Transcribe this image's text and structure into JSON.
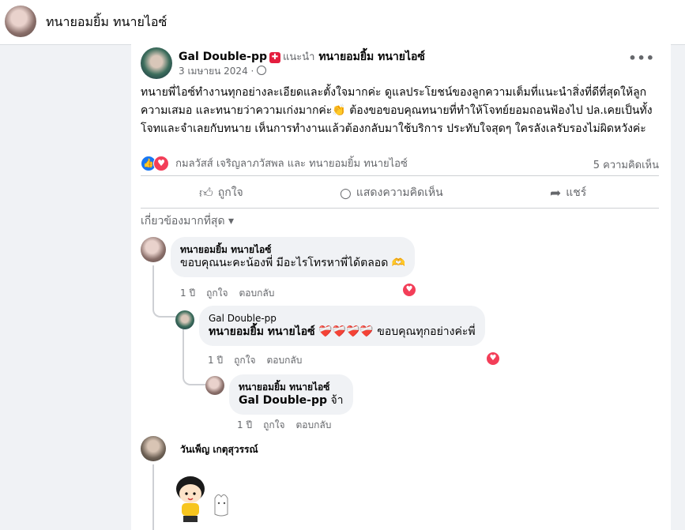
{
  "header": {
    "title": "ทนายอมยิ้ม ทนายไอซ์"
  },
  "post": {
    "author": "Gal Double-pp",
    "badge": "✚",
    "recommends_label": "แนะนำ",
    "page_name": "ทนายอมยิ้ม ทนายไอซ์",
    "date": "3 เมษายน 2024 ·",
    "more": "•••",
    "text": "ทนายพี่ไอซ์ทำงานทุกอย่างละเอียดและตั้งใจมากค่ะ ดูแลประโยชน์ของลูกความเต็มที่แนะนำสิ่งที่ดีที่สุดให้ลูกความเสมอ และทนายว่าความเก่งมากค่ะ👏 ต้องขอขอบคุณทนายที่ทำให้โจทย์ยอมถอนฟ้องไป ปล.เคยเป็นทั้งโจทและจำเลยกับทนาย เห็นการทำงานแล้วต้องกลับมาใช้บริการ ประทับใจสุดๆ ใครลังเลรับรองไม่ผิดหวังค่ะ",
    "reactions_names": "กมลวัสส์ เจริญลาภวัสพล และ ทนายอมยิ้ม ทนายไอซ์",
    "comments_count": "5 ความคิดเห็น",
    "actions": {
      "like": "ถูกใจ",
      "comment": "แสดงความคิดเห็น",
      "share": "แชร์"
    },
    "filter_label": "เกี่ยวข้องมากที่สุด ▾"
  },
  "comments": [
    {
      "name": "ทนายอมยิ้ม ทนายไอซ์",
      "text": "ขอบคุณนะคะน้องพี่ มีอะไรโทรหาพี่ได้ตลอด 🫶",
      "time": "1 ปี",
      "like": "ถูกใจ",
      "reply": "ตอบกลับ"
    },
    {
      "name": "Gal Double-pp",
      "mention": "ทนายอมยิ้ม ทนายไอซ์",
      "text": " ❤️‍🩹❤️‍🩹❤️‍🩹❤️‍🩹 ขอบคุณทุกอย่างค่ะพี่",
      "time": "1 ปี",
      "like": "ถูกใจ",
      "reply": "ตอบกลับ"
    },
    {
      "name": "ทนายอมยิ้ม ทนายไอซ์",
      "mention": "Gal Double-pp",
      "text": " จ้า",
      "time": "1 ปี",
      "like": "ถูกใจ",
      "reply": "ตอบกลับ"
    },
    {
      "name": "วันเพ็ญ เกตุสุวรรณ์"
    }
  ],
  "colors": {
    "like": "#1877f2",
    "love": "#f33e58",
    "secondary_text": "#65676b",
    "bubble": "#f0f2f5"
  }
}
